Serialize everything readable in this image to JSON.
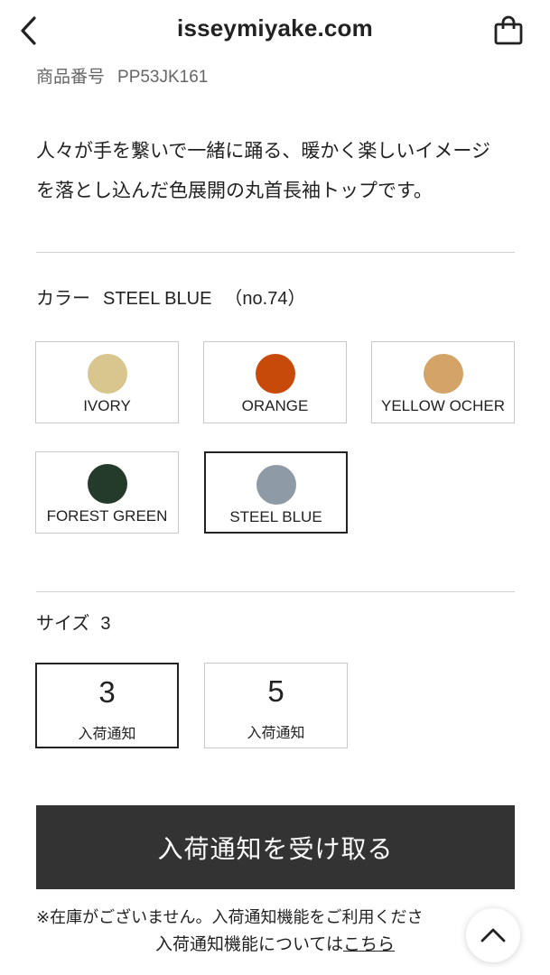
{
  "header": {
    "title": "isseymiyake.com",
    "back_icon": "chevron-left-icon",
    "bag_icon": "shopping-bag-icon"
  },
  "product": {
    "number_label": "商品番号",
    "number_value": "PP53JK161",
    "description_line1": "人々が手を繋いで一緒に踊る、暖かく楽しいイメージ",
    "description_line2": "を落とし込んだ色展開の丸首長袖トップです。"
  },
  "color": {
    "label": "カラー",
    "selected_name": "STEEL BLUE",
    "selected_code": "（no.74）",
    "options": [
      {
        "name": "IVORY",
        "hex": "#D9C68F"
      },
      {
        "name": "ORANGE",
        "hex": "#C74A0A"
      },
      {
        "name": "YELLOW OCHER",
        "hex": "#D4A367"
      },
      {
        "name": "FOREST GREEN",
        "hex": "#243A2A"
      },
      {
        "name": "STEEL BLUE",
        "hex": "#8E9AA6"
      }
    ],
    "selected_index": 4
  },
  "size": {
    "label": "サイズ",
    "selected": "3",
    "options": [
      {
        "value": "3",
        "note": "入荷通知"
      },
      {
        "value": "5",
        "note": "入荷通知"
      }
    ],
    "selected_index": 0
  },
  "notify": {
    "button_label": "入荷通知を受け取る",
    "note_line1": "※在庫がございません。入荷通知機能をご利用くださ",
    "note_line2_prefix": "入荷通知機能については",
    "note_line2_link": "こちら"
  },
  "scroll_top_icon": "chevron-up-icon",
  "colors": {
    "button_bg": "#333333",
    "selected_border": "#222222",
    "border": "#c8c8c8"
  }
}
